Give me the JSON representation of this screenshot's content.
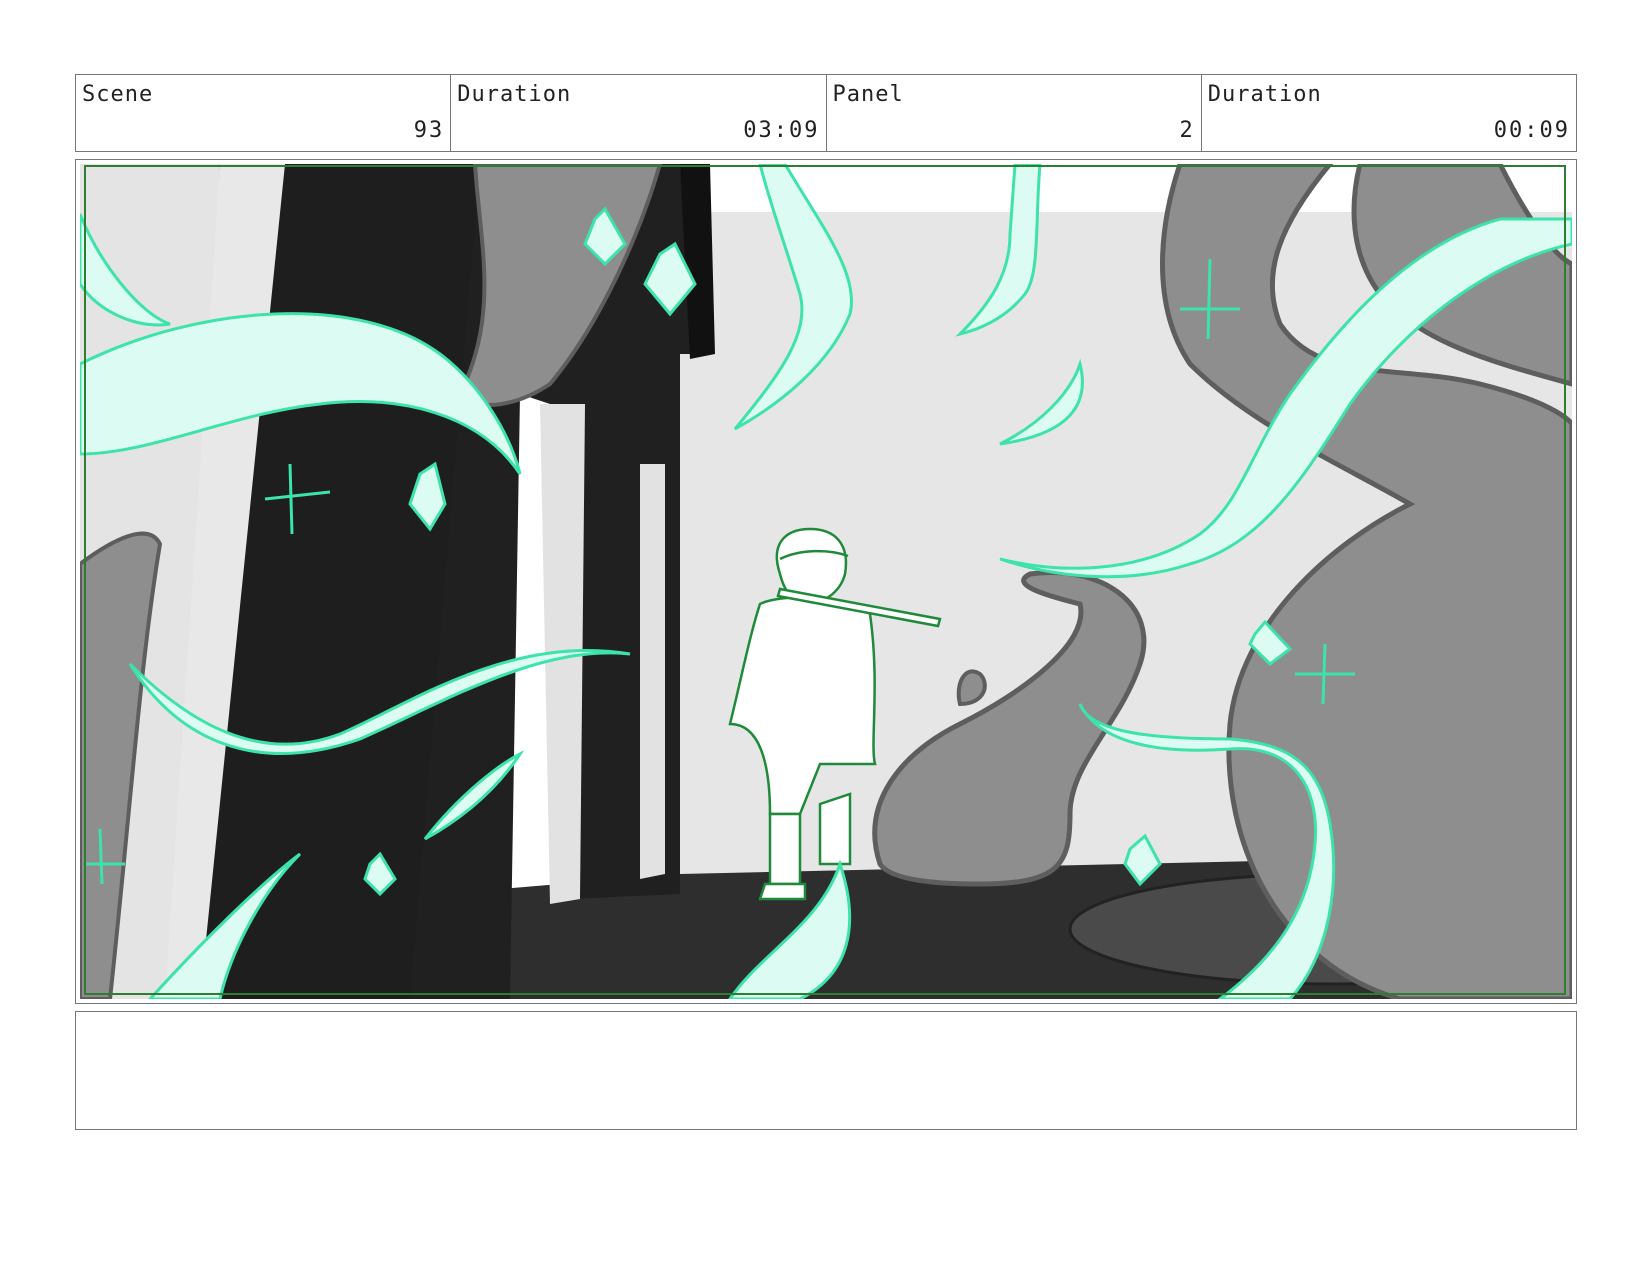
{
  "header": {
    "scene_label": "Scene",
    "scene_value": "93",
    "scene_duration_label": "Duration",
    "scene_duration_value": "03:09",
    "panel_label": "Panel",
    "panel_value": "2",
    "panel_duration_label": "Duration",
    "panel_duration_value": "00:09"
  },
  "notes": {
    "text": ""
  },
  "colors": {
    "safe_frame": "#2e7d32",
    "effect_fill": "#dcfbf3",
    "effect_stroke": "#3de3a8",
    "character_line": "#1e8a3a",
    "tentacle_fill": "#8e8e8e",
    "tentacle_line": "#5e5e5e",
    "dark_wall": "#1e1e1e",
    "light_wall": "#e4e4e4",
    "floor": "#2e2e2e"
  }
}
